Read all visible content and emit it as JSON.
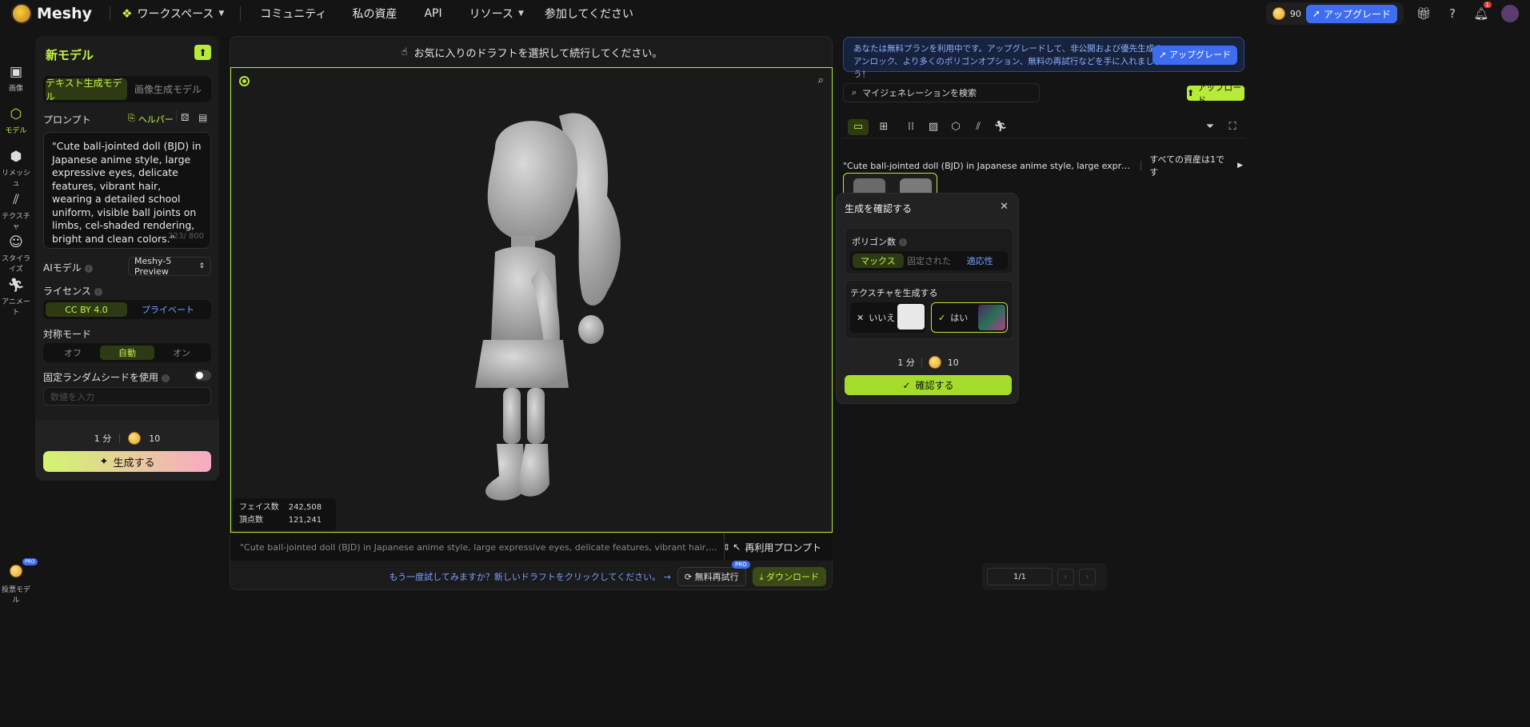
{
  "topnav": {
    "logo": "Meshy",
    "workspace": "ワークスペース",
    "community": "コミュニティ",
    "assets": "私の資産",
    "api": "API",
    "resources": "リソース",
    "join": "参加してください",
    "credits": "90",
    "upgrade": "アップグレード",
    "notif_count": "1"
  },
  "rail": {
    "items": [
      "画像",
      "モデル",
      "リメッシュ",
      "テクスチャ",
      "スタイライズ",
      "アニメート"
    ],
    "bottom": "投票モデル",
    "bottom_badge": "PRO"
  },
  "left": {
    "title": "新モデル",
    "tab_text": "テキスト生成モデル",
    "tab_image": "画像生成モデル",
    "prompt_label": "プロンプト",
    "helper": "ヘルパー",
    "prompt_text": "\"Cute ball-jointed doll (BJD) in Japanese anime style, large expressive eyes, delicate features, vibrant hair, wearing a detailed school uniform, visible ball joints on limbs, cel-shaded rendering, bright and clean colors.\"",
    "prompt_count": "223/ 800",
    "ai_model_label": "AIモデル",
    "ai_model_value": "Meshy-5 Preview",
    "license_label": "ライセンス",
    "license_cc": "CC BY 4.0",
    "license_private": "プライベート",
    "symmetry_label": "対称モード",
    "sym_off": "オフ",
    "sym_auto": "自動",
    "sym_on": "オン",
    "seed_label": "固定ランダムシードを使用",
    "seed_placeholder": "数値を入力",
    "time": "1 分",
    "cost": "10",
    "generate": "生成する"
  },
  "center": {
    "header": "お気に入りのドラフトを選択して続行してください。",
    "faces_label": "フェイス数",
    "faces_value": "242,508",
    "verts_label": "頂点数",
    "verts_value": "121,241",
    "prompt_preview": "\"Cute ball-jointed doll (BJD) in Japanese anime style, large expressive eyes, delicate features, vibrant hair, wearing a detailed school uni...",
    "reuse": "再利用プロンプト",
    "retry_hint": "もう一度試してみますか？新しいドラフトをクリックしてください。",
    "free_retry": "無料再試行",
    "pro": "PRO",
    "download": "ダウンロード"
  },
  "right": {
    "banner": "あなたは無料プランを利用中です。アップグレードして、非公開および優先生成のアンロック、より多くのポリゴンオプション、無料の再試行などを手に入れましょう！",
    "banner_btn": "アップグレード",
    "search_placeholder": "マイジェネレーションを検索",
    "upload": "アップロード",
    "group_title": "\"Cute ball-jointed doll (BJD) in Japanese anime style, large expressive eyes, delicate fe...",
    "all_assets": "すべての資産は1です",
    "page": "1/1"
  },
  "popup": {
    "title": "生成を確認する",
    "polygon_label": "ポリゴン数",
    "poly_max": "マックス",
    "poly_fixed": "固定された",
    "poly_adaptive": "適応性",
    "texture_label": "テクスチャを生成する",
    "no": "いいえ",
    "yes": "はい",
    "time": "1 分",
    "cost": "10",
    "confirm": "確認する"
  },
  "colors": {
    "accent": "#b7ea3a",
    "blue": "#3f6df0",
    "bg": "#141414"
  }
}
